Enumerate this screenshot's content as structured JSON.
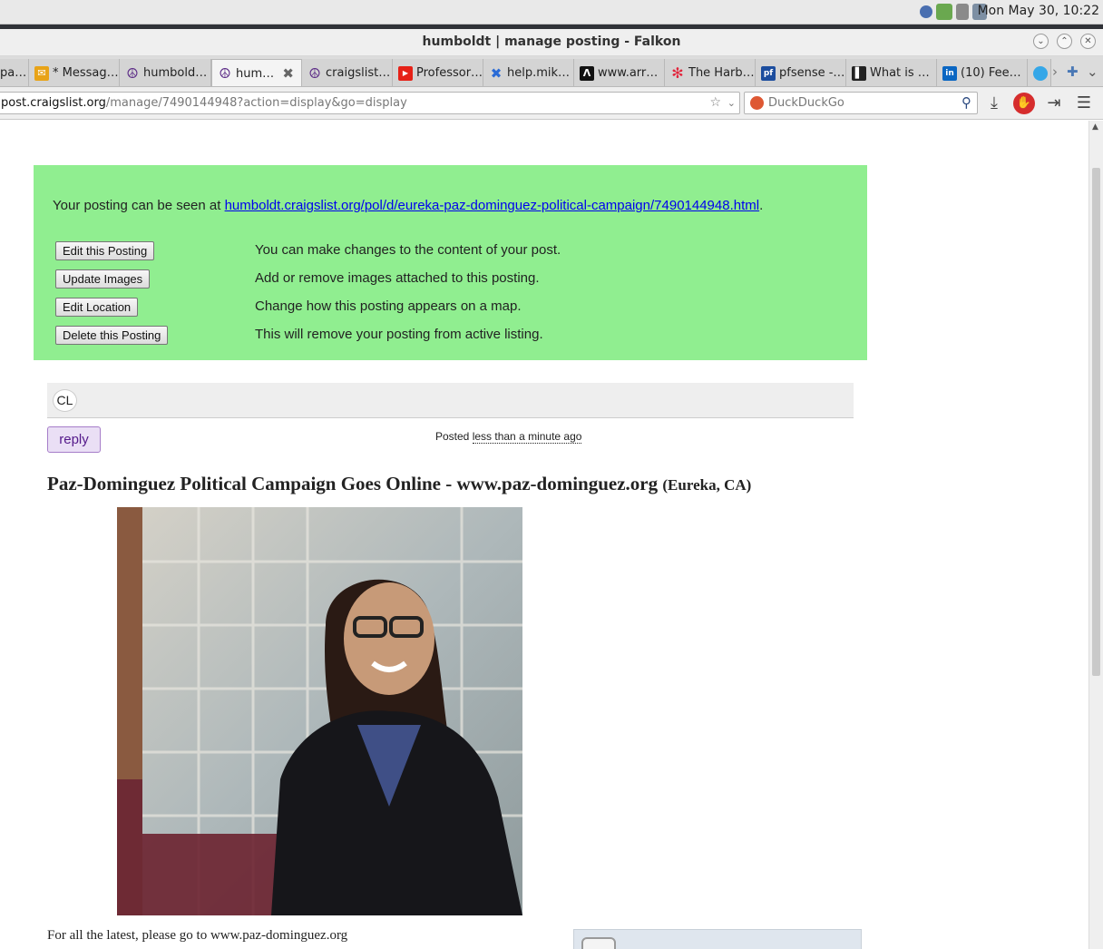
{
  "system": {
    "clock": "Mon May 30, 10:22"
  },
  "window": {
    "title": "humboldt | manage posting - Falkon"
  },
  "tabs": [
    {
      "label": "pa…",
      "favicon": "page-icon",
      "active": false
    },
    {
      "label": "* Messag…",
      "favicon": "mail-icon",
      "active": false
    },
    {
      "label": "humbold…",
      "favicon": "peace-icon",
      "active": false
    },
    {
      "label": "hum…",
      "favicon": "peace-icon",
      "active": true
    },
    {
      "label": "craigslist…",
      "favicon": "peace-icon",
      "active": false
    },
    {
      "label": "Professor…",
      "favicon": "youtube-icon",
      "active": false
    },
    {
      "label": "help.mik…",
      "favicon": "mikrotik-icon",
      "active": false
    },
    {
      "label": "www.arr…",
      "favicon": "arr-icon",
      "active": false
    },
    {
      "label": "The Harb…",
      "favicon": "asterisk-icon",
      "active": false
    },
    {
      "label": "pfsense -…",
      "favicon": "pfsense-icon",
      "active": false
    },
    {
      "label": "What is …",
      "favicon": "book-icon",
      "active": false
    },
    {
      "label": "(10) Fee…",
      "favicon": "linkedin-icon",
      "active": false
    },
    {
      "label": "",
      "favicon": "globe-icon",
      "active": false
    }
  ],
  "navbar": {
    "url_host": "post.craigslist.org",
    "url_path": "/manage/7490144948?action=display&go=display",
    "search_placeholder": "DuckDuckGo"
  },
  "manage": {
    "seen_prefix": "Your posting can be seen at ",
    "seen_link": "humboldt.craigslist.org/pol/d/eureka-paz-dominguez-political-campaign/7490144948.html",
    "seen_suffix": ".",
    "actions": [
      {
        "button": "Edit this Posting",
        "desc": "You can make changes to the content of your post."
      },
      {
        "button": "Update Images",
        "desc": "Add or remove images attached to this posting."
      },
      {
        "button": "Edit Location",
        "desc": "Change how this posting appears on a map."
      },
      {
        "button": "Delete this Posting",
        "desc": "This will remove your posting from active listing."
      }
    ]
  },
  "posting": {
    "cl_badge": "CL",
    "reply_label": "reply",
    "posted_label": "Posted",
    "posted_ago": "less than a minute ago",
    "title": "Paz-Dominguez Political Campaign Goes Online - www.paz-dominguez.org",
    "location": "(Eureka, CA)",
    "body": "For all the latest, please go to www.paz-dominguez.org"
  }
}
